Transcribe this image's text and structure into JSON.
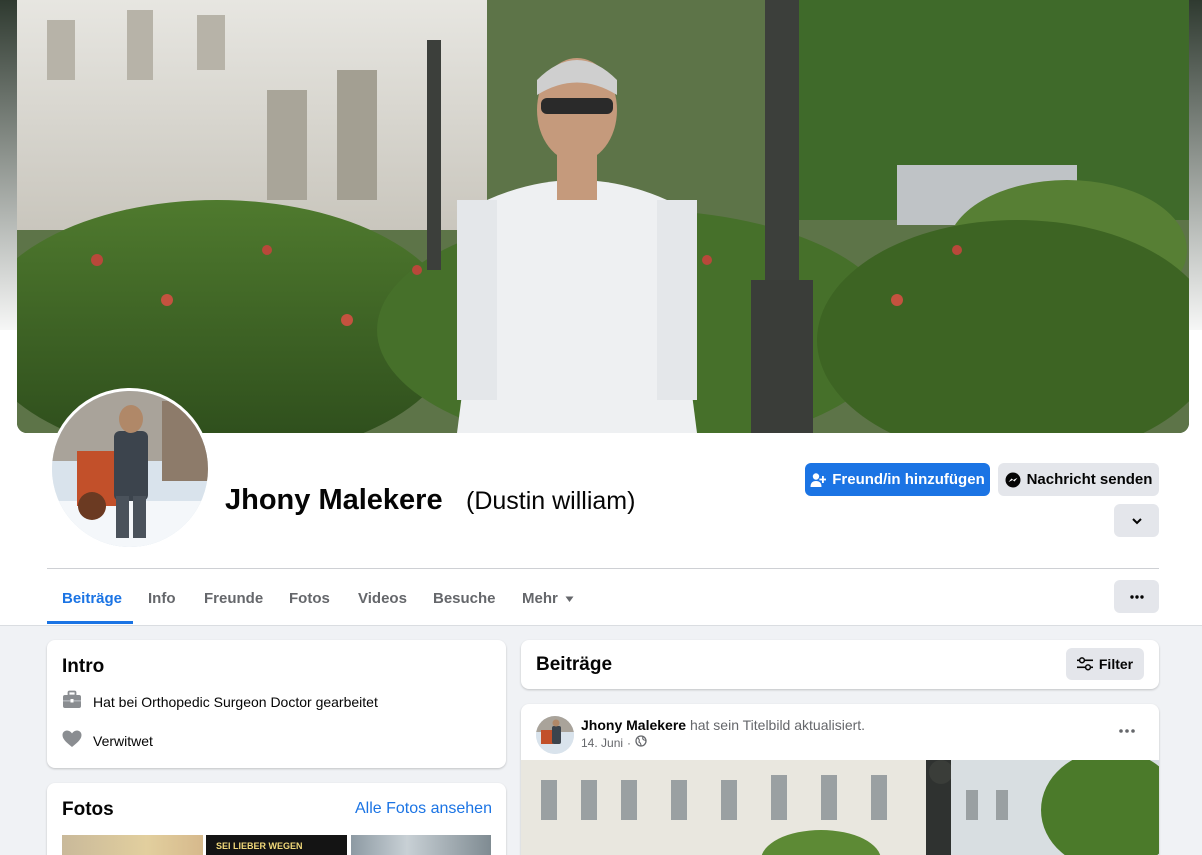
{
  "profile": {
    "name": "Jhony Malekere",
    "alternate_name": "(Dustin william)"
  },
  "actions": {
    "add_friend": "Freund/in hinzufügen",
    "send_message": "Nachricht senden"
  },
  "tabs": [
    {
      "label": "Beiträge",
      "active": true
    },
    {
      "label": "Info"
    },
    {
      "label": "Freunde"
    },
    {
      "label": "Fotos"
    },
    {
      "label": "Videos"
    },
    {
      "label": "Besuche"
    },
    {
      "label": "Mehr"
    }
  ],
  "intro": {
    "title": "Intro",
    "items": [
      {
        "icon": "briefcase-icon",
        "text": "Hat bei Orthopedic Surgeon Doctor gearbeitet"
      },
      {
        "icon": "heart-icon",
        "text": "Verwitwet"
      }
    ]
  },
  "photos": {
    "title": "Fotos",
    "see_all": "Alle Fotos ansehen",
    "thumb_text": "SEI LIEBER WEGEN"
  },
  "posts_header": {
    "title": "Beiträge",
    "filter_label": "Filter"
  },
  "post": {
    "author": "Jhony Malekere",
    "action": "hat sein Titelbild aktualisiert.",
    "date": "14. Juni",
    "separator": "·",
    "privacy_icon": "globe-icon"
  },
  "colors": {
    "primary": "#1b74e4",
    "secondary_button": "#e4e6eb",
    "page_bg": "#f0f2f5",
    "text_muted": "#65676b"
  }
}
